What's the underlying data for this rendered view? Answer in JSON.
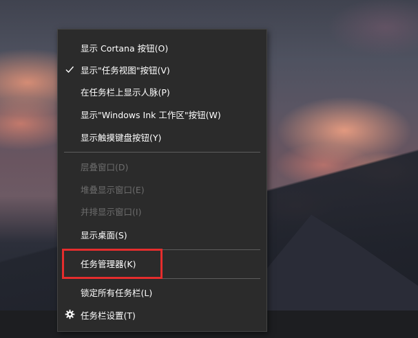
{
  "context_menu": {
    "group1": [
      {
        "label": "显示 Cortana 按钮(O)",
        "checked": false,
        "enabled": true
      },
      {
        "label": "显示\"任务视图\"按钮(V)",
        "checked": true,
        "enabled": true
      },
      {
        "label": "在任务栏上显示人脉(P)",
        "checked": false,
        "enabled": true
      },
      {
        "label": "显示\"Windows Ink 工作区\"按钮(W)",
        "checked": false,
        "enabled": true
      },
      {
        "label": "显示触摸键盘按钮(Y)",
        "checked": false,
        "enabled": true
      }
    ],
    "group2": [
      {
        "label": "层叠窗口(D)",
        "enabled": false
      },
      {
        "label": "堆叠显示窗口(E)",
        "enabled": false
      },
      {
        "label": "并排显示窗口(I)",
        "enabled": false
      },
      {
        "label": "显示桌面(S)",
        "enabled": true
      }
    ],
    "group3": [
      {
        "label": "任务管理器(K)",
        "enabled": true,
        "highlighted": true
      }
    ],
    "group4": [
      {
        "label": "锁定所有任务栏(L)",
        "enabled": true
      },
      {
        "label": "任务栏设置(T)",
        "enabled": true,
        "icon": "gear-icon"
      }
    ]
  },
  "colors": {
    "menu_bg": "#2b2b2b",
    "text": "#ffffff",
    "disabled_text": "#6d6d6d",
    "separator": "#5e5e5e",
    "highlight_box": "#e62d2d"
  }
}
